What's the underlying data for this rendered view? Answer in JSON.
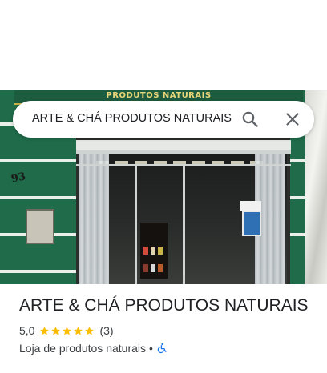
{
  "search": {
    "query": "ARTE & CHÁ PRODUTOS NATURAIS",
    "search_icon": "search-icon",
    "close_icon": "close-icon"
  },
  "photo": {
    "sign_text": "PRODUTOS NATURAIS",
    "street_number": "93"
  },
  "place": {
    "name": "ARTE & CHÁ PRODUTOS NATURAIS",
    "rating": "5,0",
    "stars": 5,
    "review_count": "(3)",
    "category": "Loja de produtos naturais",
    "separator": "•",
    "accessibility_icon": "wheelchair-icon"
  },
  "colors": {
    "star": "#fbbc04",
    "accessibility": "#1a73e8",
    "wall_green": "#1f6b4a"
  }
}
